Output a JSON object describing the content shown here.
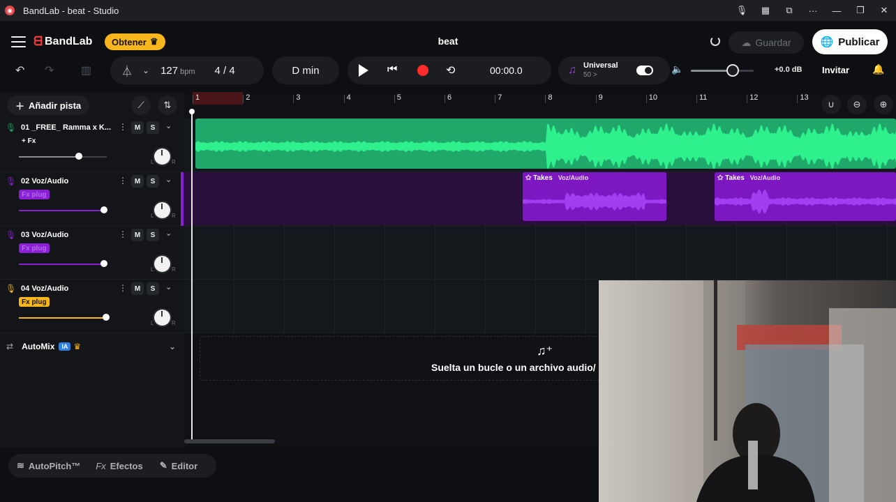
{
  "window": {
    "title": "BandLab - beat - Studio",
    "controls": [
      "mic-icon",
      "battery-icon",
      "screen-icon",
      "more-icon",
      "minimize-icon",
      "maximize-icon",
      "close-icon"
    ]
  },
  "header": {
    "brand": "BandLab",
    "obtener_label": "Obtener",
    "project_title": "beat",
    "guardar_label": "Guardar",
    "publicar_label": "Publicar",
    "brand_color": "#f23b3b",
    "accent_color": "#f7b61e"
  },
  "toolbar": {
    "tempo": "127",
    "tempo_unit": "bpm",
    "time_signature": "4 / 4",
    "key": "D min",
    "time_display": "00:00.0",
    "instrument_name": "Universal",
    "instrument_sub": "50 >",
    "volume_level": 0.6,
    "gain": "+0.0 dB",
    "invitar_label": "Invitar"
  },
  "left_panel": {
    "add_track_label": "Añadir pista",
    "tracks": [
      {
        "number": "01",
        "name": "_FREE_ Ramma x K...",
        "fx_label": "+ Fx",
        "color": "#1fa86a",
        "volume": 0.68,
        "mute": "M",
        "solo": "S",
        "pan_l": "L",
        "pan_r": "R"
      },
      {
        "number": "02",
        "name": "Voz/Audio",
        "fx_label": "Fx plug",
        "color": "#8a1fd6",
        "volume": 0.97,
        "mute": "M",
        "solo": "S",
        "pan_l": "L",
        "pan_r": "R"
      },
      {
        "number": "03",
        "name": "Voz/Audio",
        "fx_label": "Fx plug",
        "color": "#8a1fd6",
        "volume": 0.97,
        "mute": "M",
        "solo": "S",
        "pan_l": "L",
        "pan_r": "R"
      },
      {
        "number": "04",
        "name": "Voz/Audio",
        "fx_label": "Fx plug",
        "color": "#f7b61e",
        "volume": 0.99,
        "mute": "M",
        "solo": "S",
        "pan_l": "L",
        "pan_r": "R"
      }
    ],
    "automix_label": "AutoMix",
    "automix_badge": "IA"
  },
  "timeline": {
    "bars": [
      "1",
      "2",
      "3",
      "4",
      "5",
      "6",
      "7",
      "8",
      "9",
      "10",
      "11",
      "12",
      "13"
    ],
    "clips": [
      {
        "lane": 2,
        "label": "Takes",
        "track": "Voz/Audio"
      },
      {
        "lane": 2,
        "label": "Takes",
        "track": "Voz/Audio"
      }
    ],
    "dropzone_text": "Suelta un bucle o un archivo audio/"
  },
  "bottom": {
    "autopitch_label": "AutoPitch™",
    "efectos_label": "Efectos",
    "editor_label": "Editor"
  }
}
